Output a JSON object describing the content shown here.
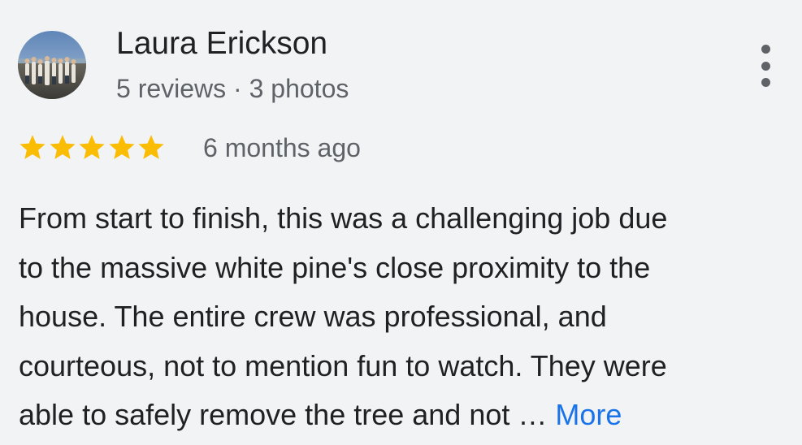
{
  "reviewer": {
    "name": "Laura Erickson",
    "meta": "5 reviews · 3 photos"
  },
  "review": {
    "rating": 5,
    "rating_max": 5,
    "date": "6 months ago",
    "text_lines": [
      "From start to finish, this was a challenging job due",
      "to the massive white pine's close proximity to the",
      "house. The entire crew was professional, and",
      "courteous, not to mention fun to watch. They were",
      "able to safely remove the tree and not …"
    ],
    "more_label": "More"
  },
  "icons": {
    "menu": "more-vert-icon",
    "star": "star-icon"
  },
  "colors": {
    "star": "#fbbc04",
    "link": "#1a73e8",
    "secondary_text": "#5f6368",
    "background": "#f1f3f4"
  }
}
